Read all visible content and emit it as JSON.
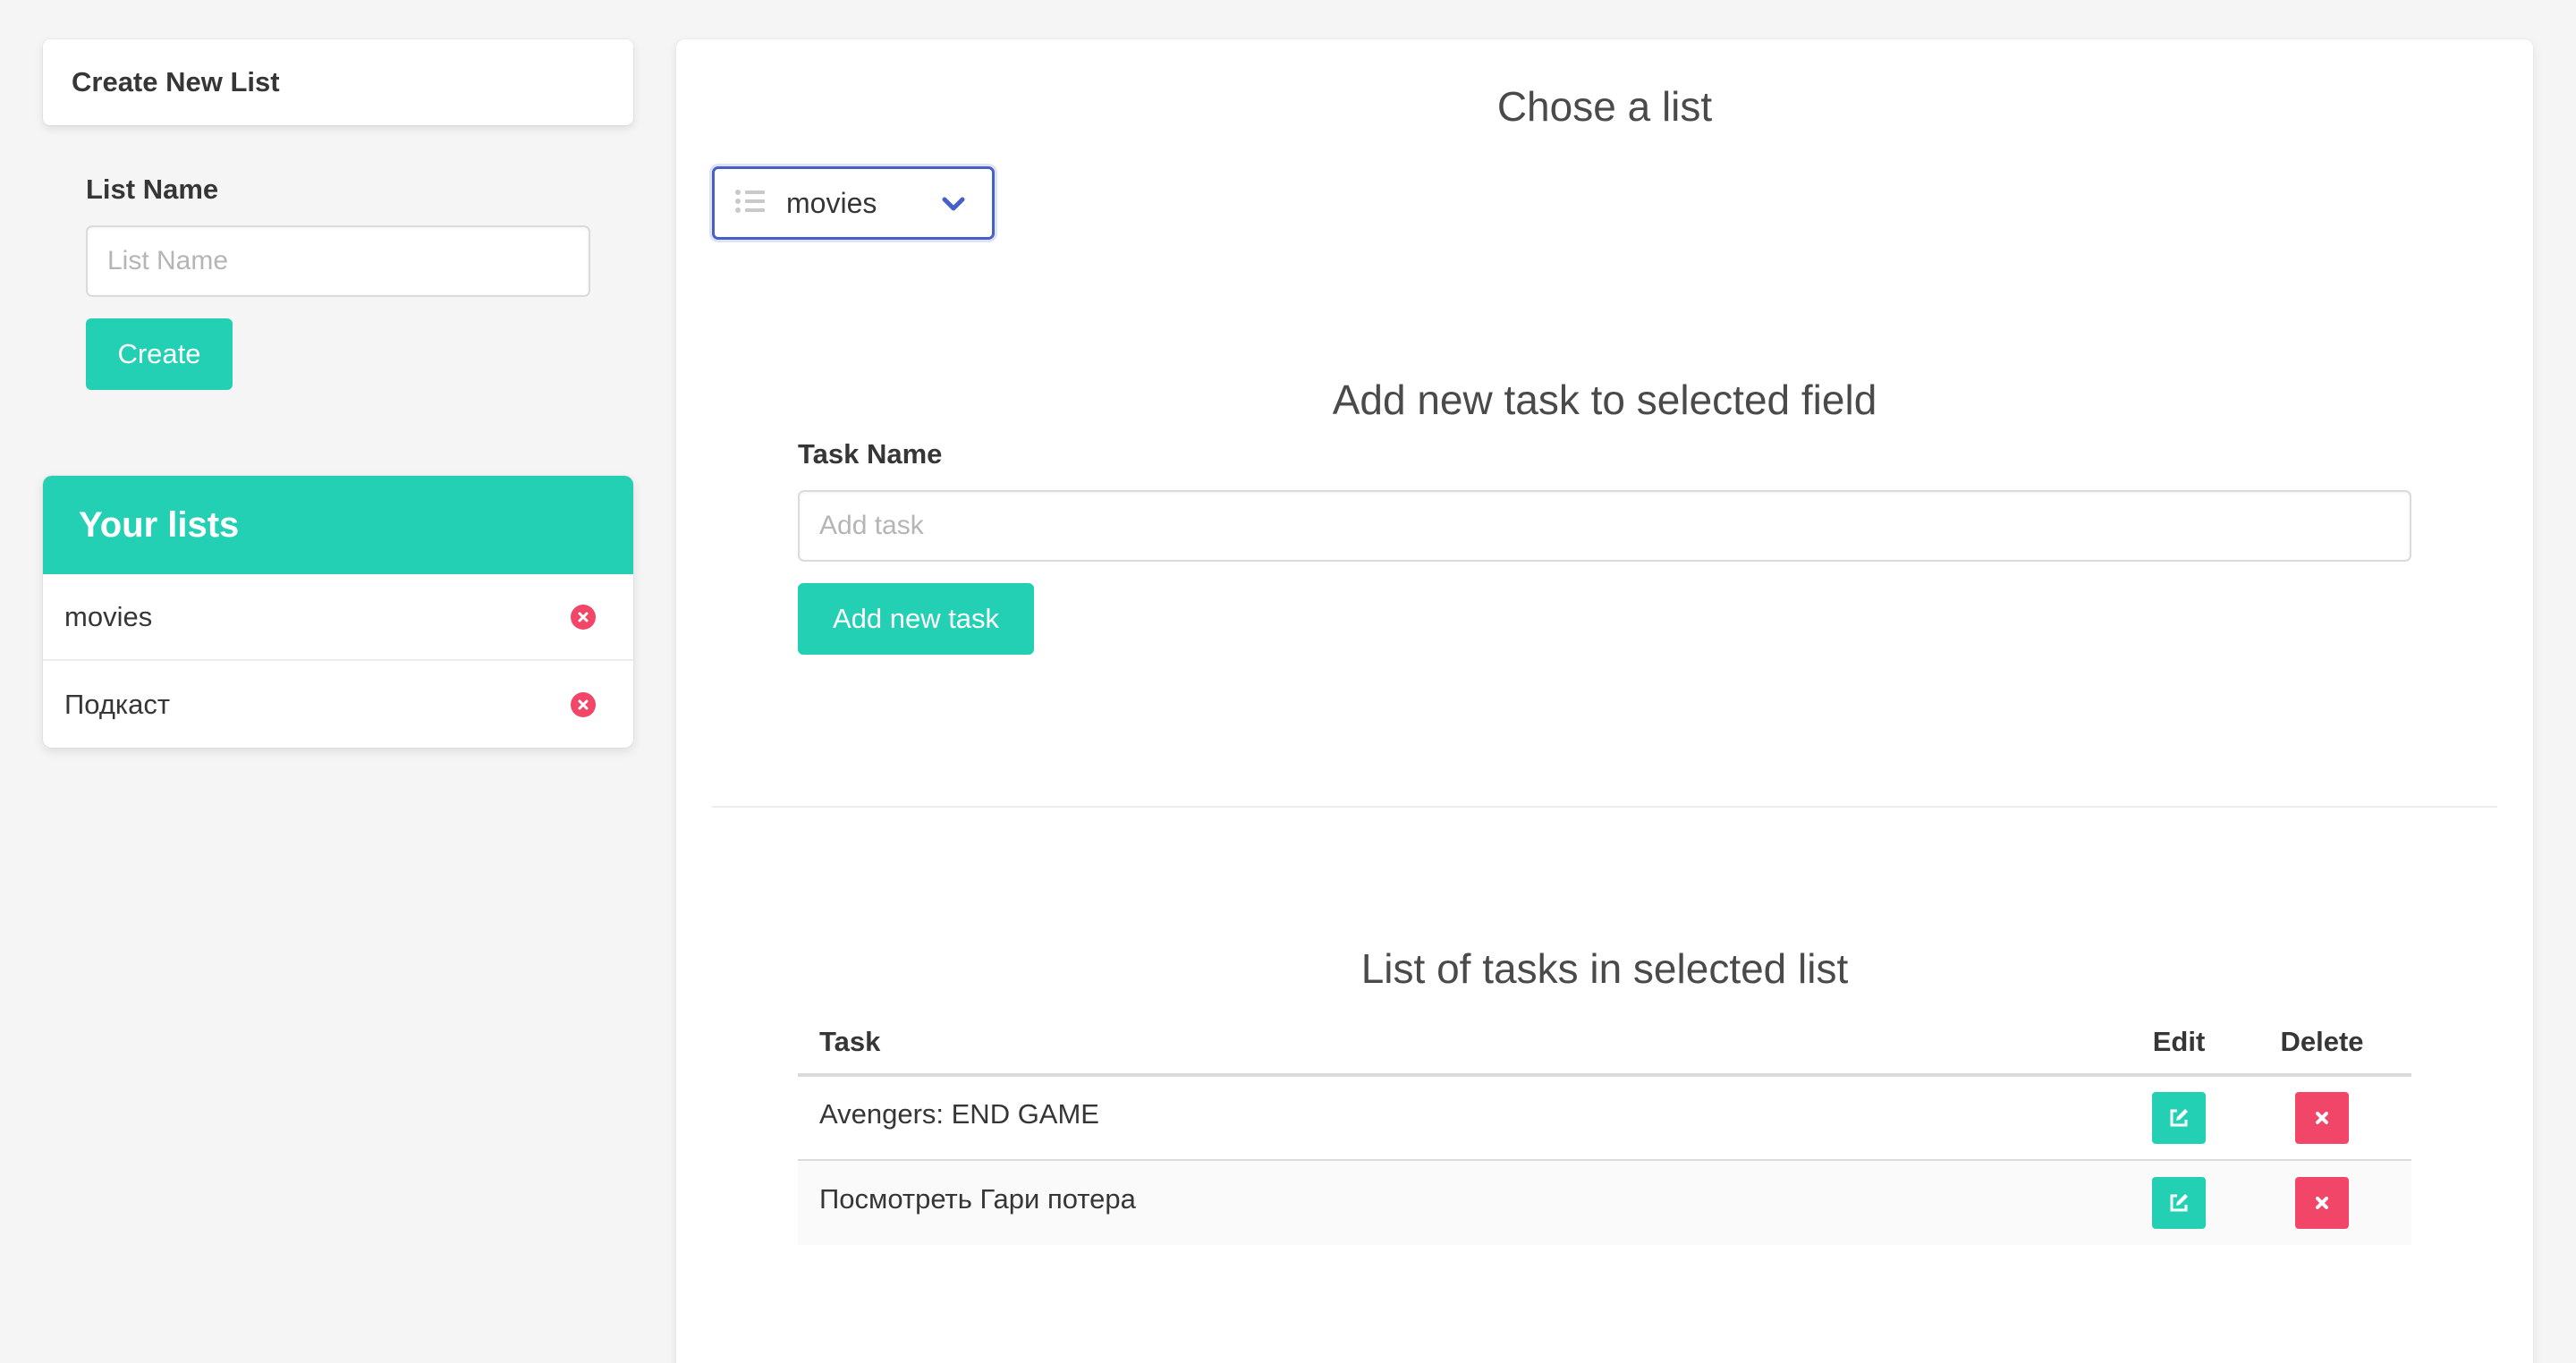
{
  "create_list": {
    "title": "Create New List",
    "field_label": "List Name",
    "placeholder": "List Name",
    "value": "",
    "button_label": "Create"
  },
  "your_lists": {
    "heading": "Your lists",
    "items": [
      {
        "name": "movies"
      },
      {
        "name": "Подкаст"
      }
    ]
  },
  "chooser": {
    "title": "Chose a list",
    "selected": "movies"
  },
  "add_task": {
    "title": "Add new task to selected field",
    "field_label": "Task Name",
    "placeholder": "Add task",
    "value": "",
    "button_label": "Add new task"
  },
  "tasks_table": {
    "title": "List of tasks in selected list",
    "columns": {
      "task": "Task",
      "edit": "Edit",
      "delete": "Delete"
    },
    "rows": [
      {
        "task": "Avengers: END GAME"
      },
      {
        "task": "Посмотреть Гари потера"
      }
    ]
  },
  "colors": {
    "primary": "#24d0b4",
    "danger": "#f14668",
    "link": "#485fc7"
  },
  "icons": {
    "list": "list-icon",
    "chevron": "chevron-down-icon",
    "remove": "times-circle-icon",
    "edit": "edit-icon",
    "delete": "times-icon"
  }
}
